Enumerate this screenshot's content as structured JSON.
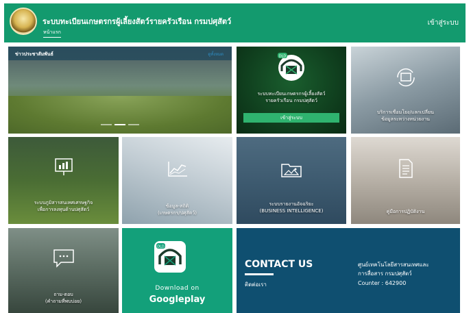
{
  "header": {
    "site_title": "ระบบทะเบียนเกษตรกรผู้เลี้ยงสัตว์รายครัวเรือน กรมปศุสัตว์",
    "home_link": "หน้าแรก",
    "login_link": "เข้าสู่ระบบ"
  },
  "news": {
    "title": "ข่าวประชาสัมพันธ์",
    "more": "ดูทั้งหมด",
    "active_slide": 2,
    "slide_count": 3
  },
  "register_tile": {
    "badge": "DLD",
    "line1": "ระบบทะเบียนเกษตรกรผู้เลี้ยงสัตว์",
    "line2": "รายครัวเรือน กรมปศุสัตว์",
    "button": "เข้าสู่ระบบ"
  },
  "tiles": {
    "exchange": {
      "line1": "บริการเชื่อมโยง/แลกเปลี่ยน",
      "line2": "ข้อมูลระหว่างหน่วยงาน",
      "icon": "sync-screen-icon"
    },
    "economics": {
      "line1": "ระบบภูมิสารสนเทศเศรษฐกิจ",
      "line2": "เพื่อการลงทุนด้านปศุสัตว์",
      "icon": "bar-chart-board-icon"
    },
    "statistics": {
      "line1": "ข้อมูล-สถิติ",
      "line2": "(เกษตรกร/ปศุสัตว์)",
      "icon": "line-chart-icon"
    },
    "bi": {
      "line1": "ระบบรายงานอัจฉริยะ",
      "line2": "(BUSINESS INTELLIGENCE)",
      "icon": "folder-image-icon"
    },
    "manual": {
      "line1": "คู่มือการปฏิบัติงาน",
      "icon": "document-icon"
    },
    "faq": {
      "line1": "ถาม-ตอบ",
      "line2": "(คำถามที่พบบ่อย)",
      "icon": "chat-bubble-icon"
    }
  },
  "download": {
    "badge": "DLD",
    "line1": "Download on",
    "line2": "Googleplay"
  },
  "contact": {
    "title": "CONTACT US",
    "subtitle": "ติดต่อเรา",
    "org_line1": "ศูนย์เทคโนโลยีสารสนเทศและ",
    "org_line2": "การสื่อสาร กรมปศุสัตว์",
    "counter": "Counter : 642900"
  },
  "colors": {
    "header_green": "#139a6e",
    "button_green": "#2fb36f",
    "download_green": "#13a07a",
    "contact_blue": "#0f4f70"
  }
}
